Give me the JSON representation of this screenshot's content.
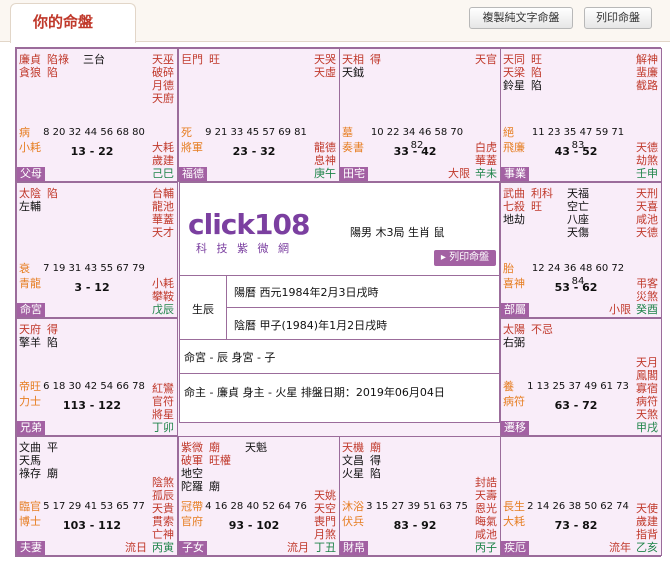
{
  "tab_title": "你的命盤",
  "buttons": {
    "text_print": "複製純文字命盤",
    "print": "列印命盤"
  },
  "center": {
    "brand": "click108",
    "brand_sub": "科 技 紫 微 網",
    "intro": "陽男 木3局 生肖 鼠",
    "print_btn": "列印命盤",
    "birth_label": "生辰",
    "solar": "陽曆 西元1984年2月3日戌時",
    "lunar": "陰曆 甲子(1984)年1月2日戌時",
    "gong": "命宮 - 辰  身宮 - 子",
    "masters": "命主 - 廉貞  身主 - 火星  排盤日期：2019年06月04日"
  },
  "cells": [
    {
      "id": "p1",
      "left_stars": [
        [
          "廉貞",
          "r"
        ],
        [
          "貪狼",
          "r"
        ]
      ],
      "left_tags": [
        [
          "陷祿",
          "r"
        ],
        [
          "陷",
          "r"
        ]
      ],
      "mid": [
        [
          "三台",
          "k"
        ]
      ],
      "right": [
        [
          "天巫",
          "r"
        ],
        [
          "破碎",
          "r"
        ],
        [
          "月德",
          "r"
        ],
        [
          "天廚",
          "r"
        ],
        [
          "大耗",
          "r"
        ],
        [
          "歲建",
          "r"
        ],
        [
          "己巳",
          "g"
        ]
      ],
      "boshi": [
        [
          "病",
          "o"
        ],
        [
          "小耗",
          "o"
        ]
      ],
      "nums": "8 20 32 44 56 68 80",
      "range": "13 - 22",
      "name": "父母"
    },
    {
      "id": "p2",
      "left_stars": [
        [
          "巨門",
          "r"
        ]
      ],
      "left_tags": [
        [
          "旺",
          "r"
        ]
      ],
      "mid": [],
      "right": [
        [
          "天哭",
          "r"
        ],
        [
          "天虛",
          "r"
        ],
        [
          "龍德",
          "r"
        ],
        [
          "息神",
          "r"
        ],
        [
          "庚午",
          "g"
        ]
      ],
      "boshi": [
        [
          "死",
          "o"
        ],
        [
          "將軍",
          "o"
        ]
      ],
      "nums": "9 21 33 45 57 69 81",
      "range": "23 - 32",
      "name": "福德"
    },
    {
      "id": "p3",
      "left_stars": [
        [
          "天相",
          "r"
        ],
        [
          "天鉞",
          "k"
        ]
      ],
      "left_tags": [
        [
          "得",
          "r"
        ]
      ],
      "mid": [],
      "right": [
        [
          "天官",
          "r"
        ],
        [
          "白虎",
          "r"
        ],
        [
          "華蓋",
          "r"
        ],
        [
          "辛未",
          "g"
        ]
      ],
      "boshi": [
        [
          "墓",
          "o"
        ],
        [
          "奏書",
          "o"
        ]
      ],
      "nums": "10 22 34 46 58 70 82",
      "range": "33 - 42",
      "name": "田宅",
      "extra": [
        [
          "大限",
          "r"
        ]
      ]
    },
    {
      "id": "p4",
      "left_stars": [
        [
          "天同",
          "r"
        ],
        [
          "天梁",
          "r"
        ],
        [
          "鈴星",
          "k"
        ]
      ],
      "left_tags": [
        [
          "旺",
          "r"
        ],
        [
          "陷",
          "r"
        ],
        [
          "陷",
          "k"
        ]
      ],
      "mid": [],
      "right": [
        [
          "解神",
          "r"
        ],
        [
          "蜚廉",
          "r"
        ],
        [
          "截路",
          "r"
        ],
        [
          "天德",
          "r"
        ],
        [
          "劫煞",
          "r"
        ],
        [
          "壬申",
          "g"
        ]
      ],
      "boshi": [
        [
          "絕",
          "o"
        ],
        [
          "飛廉",
          "o"
        ]
      ],
      "nums": "11 23 35 47 59 71 83",
      "range": "43 - 52",
      "name": "事業"
    },
    {
      "id": "p5",
      "left_stars": [
        [
          "太陰",
          "r"
        ],
        [
          "左輔",
          "k"
        ]
      ],
      "left_tags": [
        [
          "陷",
          "r"
        ]
      ],
      "mid": [],
      "right": [
        [
          "台輔",
          "r"
        ],
        [
          "龍池",
          "r"
        ],
        [
          "華蓋",
          "r"
        ],
        [
          "天才",
          "r"
        ],
        [
          "小耗",
          "r"
        ],
        [
          "攀鞍",
          "r"
        ],
        [
          "戊辰",
          "g"
        ]
      ],
      "boshi": [
        [
          "衰",
          "o"
        ],
        [
          "青龍",
          "o"
        ]
      ],
      "nums": "7 19 31 43 55 67 79",
      "range": "3 - 12",
      "name": "命宮"
    },
    {
      "id": "p6",
      "left_stars": [
        [
          "武曲",
          "r"
        ],
        [
          "七殺",
          "r"
        ],
        [
          "地劫",
          "k"
        ]
      ],
      "left_tags": [
        [
          "利科",
          "r"
        ],
        [
          "旺",
          "r"
        ]
      ],
      "mid": [
        [
          "天福",
          "k"
        ],
        [
          "空亡",
          "k"
        ],
        [
          "八座",
          "k"
        ],
        [
          "天傷",
          "k"
        ]
      ],
      "right": [
        [
          "天刑",
          "r"
        ],
        [
          "天喜",
          "r"
        ],
        [
          "咸池",
          "r"
        ],
        [
          "天德",
          "r"
        ],
        [
          "弔客",
          "r"
        ],
        [
          "災煞",
          "r"
        ],
        [
          "癸酉",
          "g"
        ]
      ],
      "boshi": [
        [
          "胎",
          "o"
        ],
        [
          "喜神",
          "o"
        ]
      ],
      "nums": "12 24 36 48 60 72 84",
      "range": "53 - 62",
      "name": "部屬",
      "extra": [
        [
          "小限",
          "r"
        ]
      ]
    },
    {
      "id": "p7",
      "left_stars": [
        [
          "天府",
          "r"
        ],
        [
          "擎羊",
          "k"
        ]
      ],
      "left_tags": [
        [
          "得",
          "r"
        ],
        [
          "陷",
          "k"
        ]
      ],
      "mid": [],
      "right": [
        [
          "紅鸞",
          "r"
        ],
        [
          "官符",
          "r"
        ],
        [
          "將星",
          "r"
        ],
        [
          "丁卯",
          "g"
        ]
      ],
      "boshi": [
        [
          "帝旺",
          "o"
        ],
        [
          "力士",
          "o"
        ]
      ],
      "nums": "6 18 30 42 54 66 78",
      "range": "113 - 122",
      "name": "兄弟"
    },
    {
      "id": "p8",
      "left_stars": [
        [
          "太陽",
          "r"
        ],
        [
          "右弼",
          "k"
        ]
      ],
      "left_tags": [
        [
          "不忌",
          "r"
        ]
      ],
      "mid": [],
      "right": [
        [
          "天月",
          "r"
        ],
        [
          "鳳閣",
          "r"
        ],
        [
          "寡宿",
          "r"
        ],
        [
          "病符",
          "r"
        ],
        [
          "天煞",
          "r"
        ],
        [
          "甲戌",
          "g"
        ]
      ],
      "boshi": [
        [
          "養",
          "o"
        ],
        [
          "病符",
          "o"
        ]
      ],
      "nums": "1 13 25 37 49 61 73",
      "range": "63 - 72",
      "name": "遷移"
    },
    {
      "id": "p9",
      "left_stars": [
        [
          "文曲",
          "k"
        ],
        [
          "天馬",
          "k"
        ],
        [
          "祿存",
          "k"
        ]
      ],
      "left_tags": [
        [
          "平",
          "k"
        ],
        [
          "",
          "k"
        ],
        [
          "廟",
          "k"
        ]
      ],
      "mid": [],
      "right": [
        [
          "陰煞",
          "r"
        ],
        [
          "孤辰",
          "r"
        ],
        [
          "天貴",
          "r"
        ],
        [
          "貫索",
          "r"
        ],
        [
          "亡神",
          "r"
        ],
        [
          "丙寅",
          "g"
        ]
      ],
      "boshi": [
        [
          "臨官",
          "o"
        ],
        [
          "博士",
          "o"
        ]
      ],
      "nums": "5 17 29 41 53 65 77",
      "range": "103 - 112",
      "name": "夫妻",
      "extra": [
        [
          "流日",
          "r"
        ]
      ]
    },
    {
      "id": "p10",
      "left_stars": [
        [
          "紫微",
          "r"
        ],
        [
          "破軍",
          "r"
        ],
        [
          "地空",
          "k"
        ],
        [
          "陀羅",
          "k"
        ]
      ],
      "left_tags": [
        [
          "廟",
          "r"
        ],
        [
          "旺權",
          "r"
        ],
        [
          "",
          "k"
        ],
        [
          "廟",
          "k"
        ]
      ],
      "mid": [
        [
          "天魁",
          "k"
        ]
      ],
      "right": [
        [
          "天姚",
          "r"
        ],
        [
          "天空",
          "r"
        ],
        [
          "喪門",
          "r"
        ],
        [
          "月煞",
          "r"
        ],
        [
          "丁丑",
          "g"
        ]
      ],
      "boshi": [
        [
          "冠帶",
          "o"
        ],
        [
          "官府",
          "o"
        ]
      ],
      "nums": "4 16 28 40 52 64 76",
      "range": "93 - 102",
      "name": "子女",
      "extra": [
        [
          "流月",
          "r"
        ]
      ]
    },
    {
      "id": "p11",
      "left_stars": [
        [
          "天機",
          "r"
        ],
        [
          "文昌",
          "k"
        ],
        [
          "火星",
          "k"
        ]
      ],
      "left_tags": [
        [
          "廟",
          "r"
        ],
        [
          "得",
          "k"
        ],
        [
          "陷",
          "k"
        ]
      ],
      "mid": [],
      "right": [
        [
          "封誥",
          "r"
        ],
        [
          "天壽",
          "r"
        ],
        [
          "恩光",
          "r"
        ],
        [
          "晦氣",
          "r"
        ],
        [
          "咸池",
          "r"
        ],
        [
          "丙子",
          "g"
        ]
      ],
      "boshi": [
        [
          "沐浴",
          "o"
        ],
        [
          "伏兵",
          "o"
        ]
      ],
      "nums": "3 15 27 39 51 63 75",
      "range": "83 - 92",
      "name": "財帛"
    },
    {
      "id": "p12",
      "left_stars": [],
      "left_tags": [],
      "mid": [],
      "right": [
        [
          "天使",
          "r"
        ],
        [
          "歲建",
          "r"
        ],
        [
          "指背",
          "r"
        ],
        [
          "乙亥",
          "g"
        ]
      ],
      "boshi": [
        [
          "長生",
          "o"
        ],
        [
          "大耗",
          "o"
        ]
      ],
      "nums": "2 14 26 38 50 62 74",
      "range": "73 - 82",
      "name": "疾厄",
      "extra": [
        [
          "流年",
          "r"
        ]
      ]
    }
  ]
}
